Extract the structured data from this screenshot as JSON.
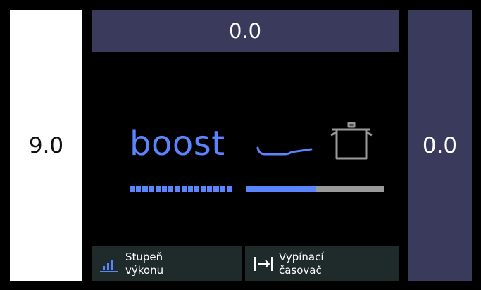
{
  "zones": {
    "left": {
      "value": "9.0"
    },
    "top": {
      "value": "0.0"
    },
    "right": {
      "value": "0.0"
    }
  },
  "center": {
    "mode_label": "boost",
    "pan_icon": "frying-pan-icon",
    "pot_icon": "cooking-pot-icon",
    "power_level_segments": 16,
    "power_level_filled": 16,
    "progress_fraction": 0.5
  },
  "buttons": {
    "power": {
      "line1": "Stupeň",
      "line2": "výkonu",
      "icon": "power-level-icon"
    },
    "timer": {
      "line1": "Vypínací",
      "line2": "časovač",
      "icon": "timer-icon"
    }
  },
  "colors": {
    "accent": "#5b84ff",
    "zone_bg": "#3a3a5c",
    "button_bg": "#1f2a2a",
    "inactive": "#9a9a9a"
  }
}
